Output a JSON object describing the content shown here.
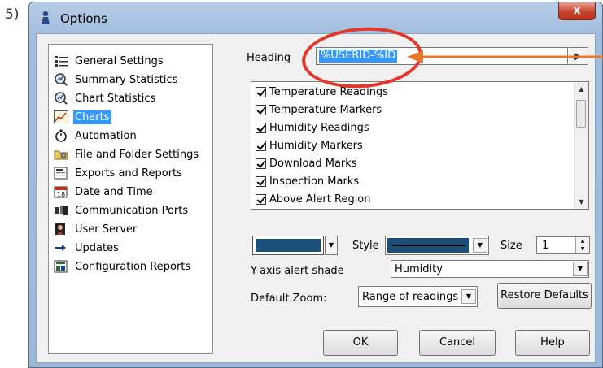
{
  "step_label": "5)",
  "window": {
    "title": "Options",
    "close_label": "x"
  },
  "tree": {
    "items": [
      {
        "label": "General Settings",
        "icon": "settings-list-icon"
      },
      {
        "label": "Summary Statistics",
        "icon": "magnifier-stats-icon"
      },
      {
        "label": "Chart Statistics",
        "icon": "magnifier-stats-icon"
      },
      {
        "label": "Charts",
        "icon": "line-chart-icon",
        "selected": true
      },
      {
        "label": "Automation",
        "icon": "stopwatch-icon"
      },
      {
        "label": "File and Folder Settings",
        "icon": "folder-icon"
      },
      {
        "label": "Exports and Reports",
        "icon": "report-icon"
      },
      {
        "label": "Date and Time",
        "icon": "calendar-icon"
      },
      {
        "label": "Communication Ports",
        "icon": "port-icon"
      },
      {
        "label": "User Server",
        "icon": "user-server-icon"
      },
      {
        "label": "Updates",
        "icon": "arrow-right-icon"
      },
      {
        "label": "Configuration Reports",
        "icon": "config-report-icon"
      }
    ]
  },
  "heading": {
    "label": "Heading",
    "value": "%USERID-%ID"
  },
  "series_list": {
    "items": [
      {
        "label": "Temperature Readings",
        "checked": true
      },
      {
        "label": "Temperature Markers",
        "checked": true
      },
      {
        "label": "Humidity Readings",
        "checked": true
      },
      {
        "label": "Humidity Markers",
        "checked": true
      },
      {
        "label": "Download Marks",
        "checked": true
      },
      {
        "label": "Inspection Marks",
        "checked": true
      },
      {
        "label": "Above Alert Region",
        "checked": true
      }
    ]
  },
  "line_color": "#1c4e7a",
  "style": {
    "label": "Style"
  },
  "size": {
    "label": "Size",
    "value": "1"
  },
  "y_alert": {
    "label": "Y-axis alert shade",
    "value": "Humidity"
  },
  "zoom": {
    "label": "Default Zoom:",
    "value": "Range of readings"
  },
  "buttons": {
    "restore": "Restore Defaults",
    "ok": "OK",
    "cancel": "Cancel",
    "help": "Help"
  },
  "colors": {
    "selection": "#3399ff",
    "annotation_red": "#e2372a",
    "annotation_orange": "#e8782a"
  }
}
